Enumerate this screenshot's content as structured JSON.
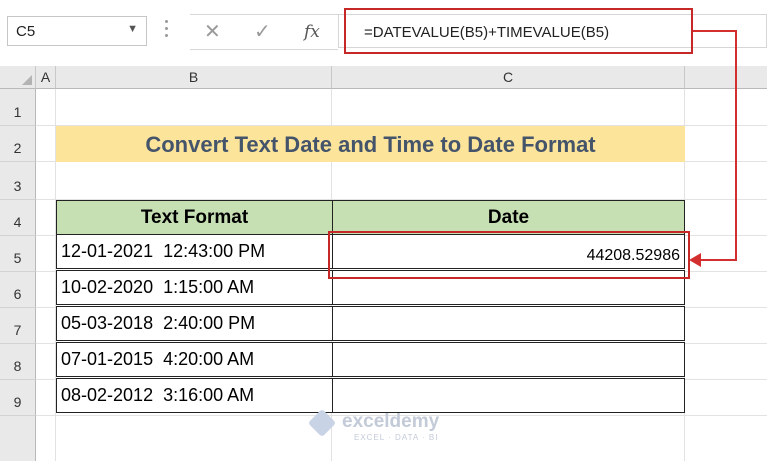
{
  "formula_bar": {
    "name_box": "C5",
    "cancel_icon": "✕",
    "enter_icon": "✓",
    "fx_label": "fx",
    "formula": "=DATEVALUE(B5)+TIMEVALUE(B5)"
  },
  "columns": [
    "A",
    "B",
    "C"
  ],
  "rows": [
    "1",
    "2",
    "3",
    "4",
    "5",
    "6",
    "7",
    "8",
    "9"
  ],
  "sheet": {
    "title": "Convert Text Date and Time to Date Format",
    "headers": {
      "text_format": "Text Format",
      "date": "Date"
    },
    "data": [
      {
        "text": "12-01-2021  12:43:00 PM",
        "date": "44208.52986"
      },
      {
        "text": "10-02-2020  1:15:00 AM",
        "date": ""
      },
      {
        "text": "05-03-2018  2:40:00 PM",
        "date": ""
      },
      {
        "text": "07-01-2015  4:20:00 AM",
        "date": ""
      },
      {
        "text": "08-02-2012  3:16:00 AM",
        "date": ""
      }
    ]
  },
  "watermark": {
    "name": "exceldemy",
    "tagline": "EXCEL · DATA · BI"
  },
  "colors": {
    "title_fill": "#fde49b",
    "header_fill": "#c6e0b4",
    "highlight": "#c62828",
    "title_text": "#44546a"
  }
}
